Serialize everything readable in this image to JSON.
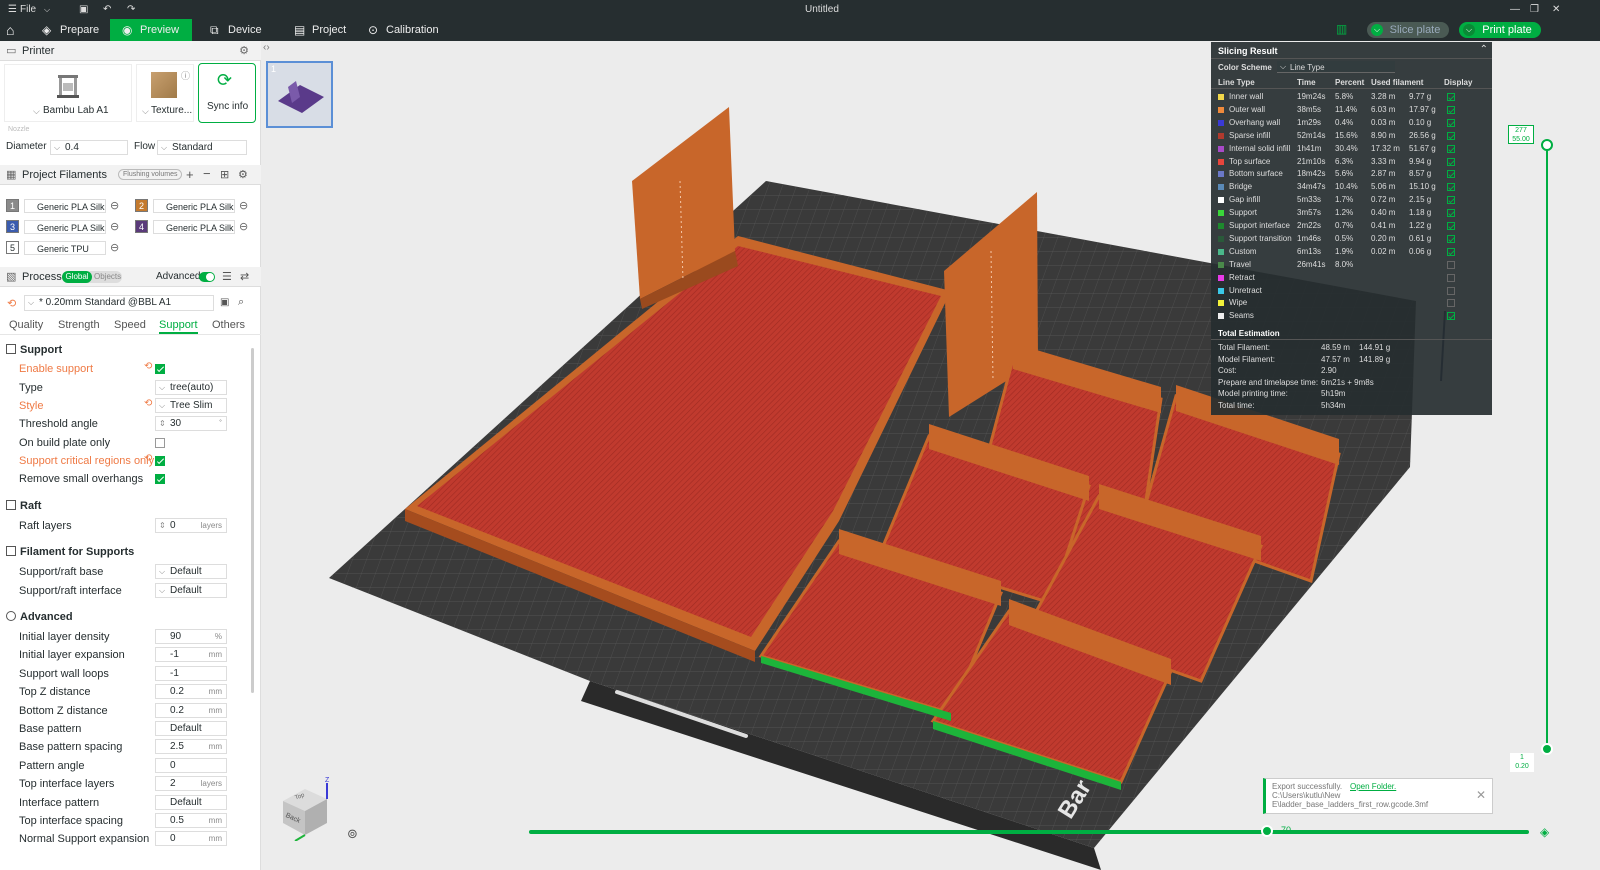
{
  "titlebar": {
    "file_label": "File",
    "doc_title": "Untitled"
  },
  "menu": {
    "tabs": [
      {
        "label": "Prepare",
        "icon": "prepare-icon"
      },
      {
        "label": "Preview",
        "icon": "preview-icon"
      },
      {
        "label": "Device",
        "icon": "device-icon"
      },
      {
        "label": "Project",
        "icon": "project-icon"
      },
      {
        "label": "Calibration",
        "icon": "calibration-icon"
      }
    ],
    "active_tab": "Preview",
    "slice_label": "Slice plate",
    "print_label": "Print plate"
  },
  "printer": {
    "header": "Printer",
    "model": "Bambu Lab A1",
    "plate": "Texture...",
    "sync": "Sync info",
    "nozzle_label": "Nozzle",
    "diameter_label": "Diameter",
    "diameter_value": "0.4",
    "flow_label": "Flow",
    "flow_value": "Standard"
  },
  "filaments": {
    "header": "Project Filaments",
    "flushing": "Flushing volumes",
    "items": [
      {
        "num": "1",
        "name": "Generic PLA Silk",
        "color": "#8a8a8a"
      },
      {
        "num": "2",
        "name": "Generic PLA Silk",
        "color": "#c47a2e"
      },
      {
        "num": "3",
        "name": "Generic PLA Silk",
        "color": "#3b5cae"
      },
      {
        "num": "4",
        "name": "Generic PLA Silk",
        "color": "#5a3a7a"
      },
      {
        "num": "5",
        "name": "Generic TPU",
        "color": "#ffffff"
      }
    ]
  },
  "process": {
    "header": "Process",
    "global": "Global",
    "objects": "Objects",
    "advanced": "Advanced",
    "profile": "* 0.20mm Standard @BBL A1",
    "tabs": [
      "Quality",
      "Strength",
      "Speed",
      "Support",
      "Others"
    ],
    "active_tab": "Support"
  },
  "support": {
    "group": "Support",
    "enable_label": "Enable support",
    "type_label": "Type",
    "type_value": "tree(auto)",
    "style_label": "Style",
    "style_value": "Tree Slim",
    "threshold_label": "Threshold angle",
    "threshold_value": "30",
    "build_plate_label": "On build plate only",
    "critical_label": "Support critical regions only",
    "remove_small_label": "Remove small overhangs"
  },
  "raft": {
    "group": "Raft",
    "layers_label": "Raft layers",
    "layers_value": "0",
    "layers_unit": "layers"
  },
  "filament_supports": {
    "group": "Filament for Supports",
    "base_label": "Support/raft base",
    "base_value": "Default",
    "interface_label": "Support/raft interface",
    "interface_value": "Default"
  },
  "advanced": {
    "group": "Advanced",
    "rows": [
      {
        "label": "Initial layer density",
        "value": "90",
        "unit": "%"
      },
      {
        "label": "Initial layer expansion",
        "value": "-1",
        "unit": "mm"
      },
      {
        "label": "Support wall loops",
        "value": "-1",
        "unit": ""
      },
      {
        "label": "Top Z distance",
        "value": "0.2",
        "unit": "mm"
      },
      {
        "label": "Bottom Z distance",
        "value": "0.2",
        "unit": "mm"
      },
      {
        "label": "Base pattern",
        "value": "Default",
        "unit": ""
      },
      {
        "label": "Base pattern spacing",
        "value": "2.5",
        "unit": "mm"
      },
      {
        "label": "Pattern angle",
        "value": "0",
        "unit": ""
      },
      {
        "label": "Top interface layers",
        "value": "2",
        "unit": "layers"
      },
      {
        "label": "Interface pattern",
        "value": "Default",
        "unit": ""
      },
      {
        "label": "Top interface spacing",
        "value": "0.5",
        "unit": "mm"
      },
      {
        "label": "Normal Support expansion",
        "value": "0",
        "unit": "mm"
      }
    ]
  },
  "slicing": {
    "title": "Slicing Result",
    "color_scheme_label": "Color Scheme",
    "color_scheme_value": "Line Type",
    "headers": [
      "Line Type",
      "Time",
      "Percent",
      "Used filament",
      "Display"
    ],
    "rows": [
      {
        "name": "Inner wall",
        "color": "#f2d84a",
        "time": "19m24s",
        "pct": "5.8%",
        "len": "3.28 m",
        "g": "9.77 g",
        "on": true
      },
      {
        "name": "Outer wall",
        "color": "#f08a3c",
        "time": "38m5s",
        "pct": "11.4%",
        "len": "6.03 m",
        "g": "17.97 g",
        "on": true
      },
      {
        "name": "Overhang wall",
        "color": "#3a3ad6",
        "time": "1m29s",
        "pct": "0.4%",
        "len": "0.03 m",
        "g": "0.10 g",
        "on": true
      },
      {
        "name": "Sparse infill",
        "color": "#b03a2e",
        "time": "52m14s",
        "pct": "15.6%",
        "len": "8.90 m",
        "g": "26.56 g",
        "on": true
      },
      {
        "name": "Internal solid infill",
        "color": "#a84ac8",
        "time": "1h41m",
        "pct": "30.4%",
        "len": "17.32 m",
        "g": "51.67 g",
        "on": true
      },
      {
        "name": "Top surface",
        "color": "#e8453c",
        "time": "21m10s",
        "pct": "6.3%",
        "len": "3.33 m",
        "g": "9.94 g",
        "on": true
      },
      {
        "name": "Bottom surface",
        "color": "#6a78c8",
        "time": "18m42s",
        "pct": "5.6%",
        "len": "2.87 m",
        "g": "8.57 g",
        "on": true
      },
      {
        "name": "Bridge",
        "color": "#5a8ab8",
        "time": "34m47s",
        "pct": "10.4%",
        "len": "5.06 m",
        "g": "15.10 g",
        "on": true
      },
      {
        "name": "Gap infill",
        "color": "#ffffff",
        "time": "5m33s",
        "pct": "1.7%",
        "len": "0.72 m",
        "g": "2.15 g",
        "on": true
      },
      {
        "name": "Support",
        "color": "#3ad63a",
        "time": "3m57s",
        "pct": "1.2%",
        "len": "0.40 m",
        "g": "1.18 g",
        "on": true
      },
      {
        "name": "Support interface",
        "color": "#1e8a2e",
        "time": "2m22s",
        "pct": "0.7%",
        "len": "0.41 m",
        "g": "1.22 g",
        "on": true
      },
      {
        "name": "Support transition",
        "color": "#2a5a3a",
        "time": "1m46s",
        "pct": "0.5%",
        "len": "0.20 m",
        "g": "0.61 g",
        "on": true
      },
      {
        "name": "Custom",
        "color": "#4ab88a",
        "time": "6m13s",
        "pct": "1.9%",
        "len": "0.02 m",
        "g": "0.06 g",
        "on": true
      },
      {
        "name": "Travel",
        "color": "#4a8a4a",
        "time": "26m41s",
        "pct": "8.0%",
        "len": "",
        "g": "",
        "on": false
      },
      {
        "name": "Retract",
        "color": "#e83ae8",
        "time": "",
        "pct": "",
        "len": "",
        "g": "",
        "on": false
      },
      {
        "name": "Unretract",
        "color": "#3ac8e8",
        "time": "",
        "pct": "",
        "len": "",
        "g": "",
        "on": false
      },
      {
        "name": "Wipe",
        "color": "#f2f23a",
        "time": "",
        "pct": "",
        "len": "",
        "g": "",
        "on": false
      },
      {
        "name": "Seams",
        "color": "#eeeeee",
        "time": "",
        "pct": "",
        "len": "",
        "g": "",
        "on": true
      }
    ],
    "total_title": "Total Estimation",
    "totals": [
      {
        "label": "Total Filament:",
        "v1": "48.59 m",
        "v2": "144.91 g"
      },
      {
        "label": "Model Filament:",
        "v1": "47.57 m",
        "v2": "141.89 g"
      },
      {
        "label": "Cost:",
        "v1": "2.90",
        "v2": ""
      },
      {
        "label": "Prepare and timelapse time:",
        "v1": "6m21s + 9m8s",
        "v2": ""
      },
      {
        "label": "Model printing time:",
        "v1": "5h19m",
        "v2": ""
      },
      {
        "label": "Total time:",
        "v1": "5h34m",
        "v2": ""
      }
    ]
  },
  "plate": {
    "number": "1"
  },
  "layer_slider": {
    "top_layer": "277",
    "top_height": "55.00",
    "bottom_layer": "1",
    "bottom_height": "0.20"
  },
  "move_slider": {
    "value": "70"
  },
  "viewcube": {
    "top": "Top",
    "front": "Back",
    "axis_z": "Z"
  },
  "bed_label": "Bar",
  "toast": {
    "title": "Export successfully.",
    "link": "Open Folder.",
    "path": "C:\\Users\\kutlu\\New E\\ladder_base_ladders_first_row.gcode.3mf"
  },
  "colors": {
    "accent": "#00ae42",
    "dark": "#262e30",
    "model": "#c44a2a",
    "wall": "#c8662a"
  }
}
